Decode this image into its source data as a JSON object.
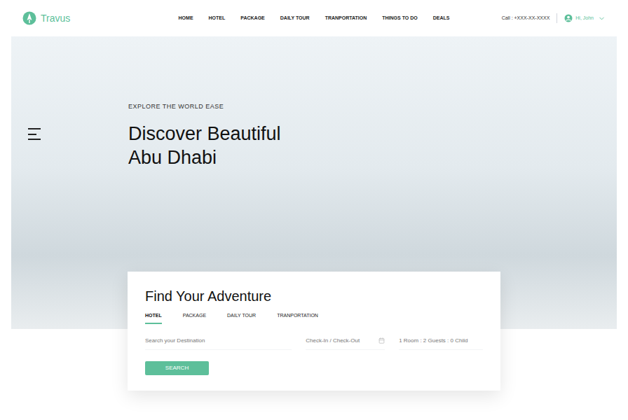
{
  "brand": {
    "name": "Travus"
  },
  "nav": [
    {
      "label": "HOME"
    },
    {
      "label": "HOTEL"
    },
    {
      "label": "PACKAGE"
    },
    {
      "label": "DAILY TOUR"
    },
    {
      "label": "TRANPORTATION"
    },
    {
      "label": "THINGS TO DO"
    },
    {
      "label": "DEALS"
    }
  ],
  "contact": {
    "phone": "Call : +XXX-XX-XXXX"
  },
  "user": {
    "greeting": "Hi, John"
  },
  "hero": {
    "eyebrow": "EXPLORE THE WORLD EASE",
    "title_lines": [
      "Discover Beautiful",
      "Abu Dhabi"
    ]
  },
  "search": {
    "title": "Find Your Adventure",
    "tabs": [
      {
        "label": "HOTEL",
        "selected": true
      },
      {
        "label": "PACKAGE",
        "selected": false
      },
      {
        "label": "DAILY TOUR",
        "selected": false
      },
      {
        "label": "TRANPORTATION",
        "selected": false
      }
    ],
    "destination_placeholder": "Search your Destination",
    "dates_placeholder": "Check-In / Check-Out",
    "guests": "1 Room : 2 Guests : 0 Child",
    "button": "SEARCH"
  }
}
